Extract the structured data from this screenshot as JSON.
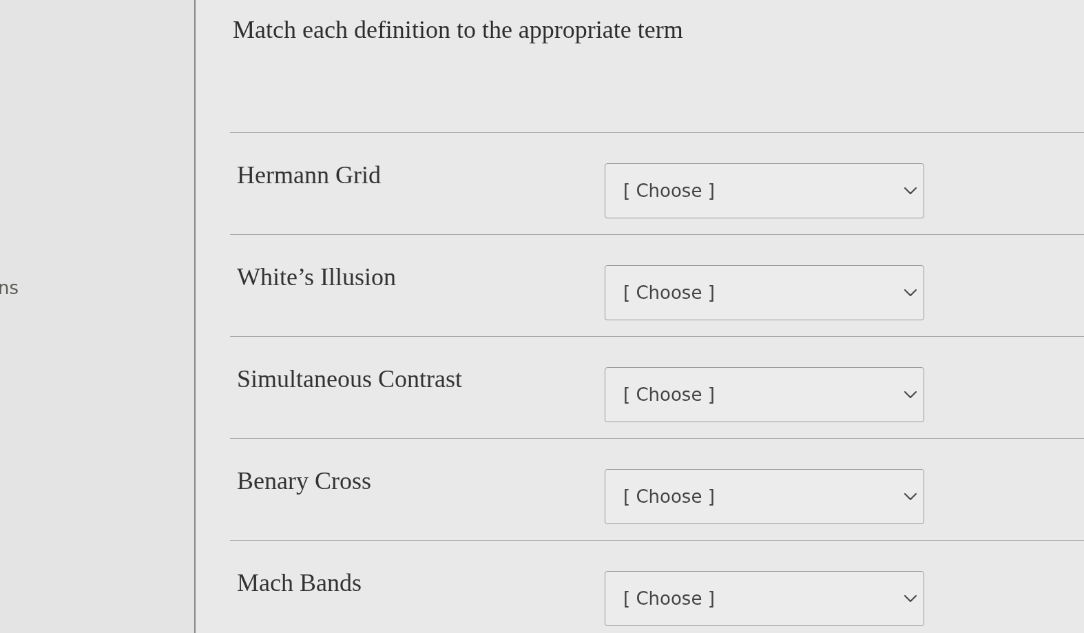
{
  "sidebar": {
    "text_fragment": "ns"
  },
  "question": {
    "prompt": "Match each definition to the appropriate term",
    "matches": [
      {
        "term": "Hermann Grid",
        "selection": "[ Choose ]"
      },
      {
        "term": "White’s Illusion",
        "selection": "[ Choose ]"
      },
      {
        "term": "Simultaneous Contrast",
        "selection": "[ Choose ]"
      },
      {
        "term": "Benary Cross",
        "selection": "[ Choose ]"
      },
      {
        "term": "Mach Bands",
        "selection": "[ Choose ]"
      }
    ]
  }
}
